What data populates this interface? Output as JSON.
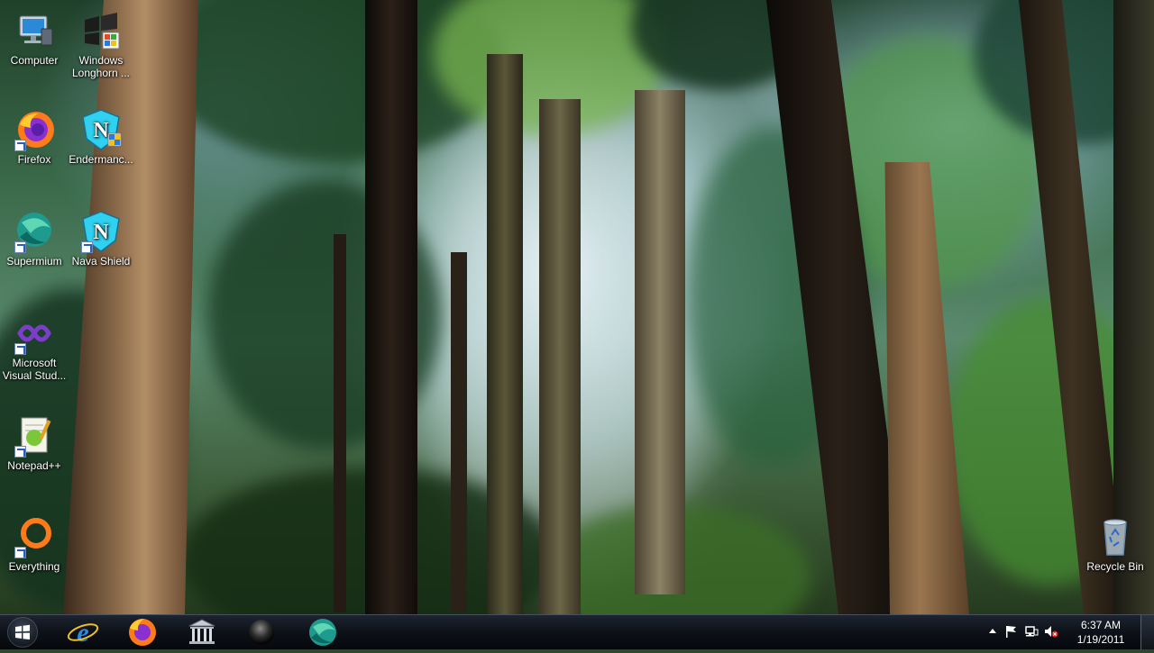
{
  "desktop": {
    "icons": [
      {
        "label": "Computer",
        "icon": "computer-icon"
      },
      {
        "label": "Windows Longhorn ...",
        "icon": "windows-setup-icon"
      },
      {
        "label": "Firefox",
        "icon": "firefox-icon"
      },
      {
        "label": "Endermanc...",
        "icon": "shield-n-icon"
      },
      {
        "label": "Supermium",
        "icon": "supermium-icon"
      },
      {
        "label": "Nava Shield",
        "icon": "shield-n-icon"
      },
      {
        "label": "Microsoft Visual Stud...",
        "icon": "visual-studio-icon"
      },
      {
        "label": "Notepad++",
        "icon": "notepad-plus-plus-icon"
      },
      {
        "label": "Everything",
        "icon": "everything-search-icon"
      },
      {
        "label": "Recycle Bin",
        "icon": "recycle-bin-icon"
      }
    ]
  },
  "taskbar": {
    "pinned": [
      {
        "name": "Internet Explorer",
        "icon": "internet-explorer-icon"
      },
      {
        "name": "Firefox",
        "icon": "firefox-icon"
      },
      {
        "name": "Library",
        "icon": "library-icon"
      },
      {
        "name": "Dark sphere app",
        "icon": "sphere-icon"
      },
      {
        "name": "Supermium",
        "icon": "supermium-icon"
      }
    ],
    "clock": {
      "time": "6:37 AM",
      "date": "1/19/2011"
    }
  },
  "colors": {
    "taskbar": "#0d1118",
    "text": "#ffffff",
    "firefox_orange": "#ff7a1a",
    "nava_cyan": "#2fd0f0"
  }
}
